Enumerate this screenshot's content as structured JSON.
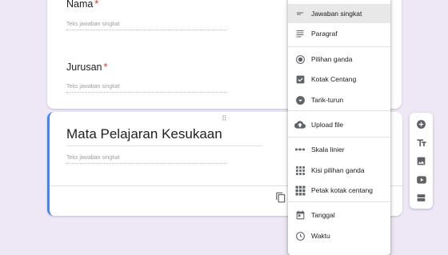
{
  "questions": [
    {
      "label": "Nama",
      "required_mark": "*",
      "answer_placeholder": "Teks jawaban singkat"
    },
    {
      "label": "Jurusan",
      "required_mark": "*",
      "answer_placeholder": "Teks jawaban singkat"
    }
  ],
  "active_question": {
    "drag_handle": "⠿",
    "title": "Mata Pelajaran Kesukaan",
    "answer_placeholder": "Teks jawaban singkat"
  },
  "type_menu": {
    "items": [
      {
        "label": "Jawaban singkat",
        "icon": "short-text-icon",
        "selected": true
      },
      {
        "label": "Paragraf",
        "icon": "paragraph-icon"
      },
      {
        "label": "Pilihan ganda",
        "icon": "radio-icon"
      },
      {
        "label": "Kotak Centang",
        "icon": "checkbox-icon"
      },
      {
        "label": "Tarik-turun",
        "icon": "dropdown-icon"
      },
      {
        "label": "Upload file",
        "icon": "cloud-upload-icon"
      },
      {
        "label": "Skala linier",
        "icon": "linear-scale-icon"
      },
      {
        "label": "Kisi pilihan ganda",
        "icon": "grid-icon"
      },
      {
        "label": "Petak kotak centang",
        "icon": "checkbox-grid-icon"
      },
      {
        "label": "Tanggal",
        "icon": "calendar-icon"
      },
      {
        "label": "Waktu",
        "icon": "clock-icon"
      }
    ]
  },
  "side_toolbar": {
    "buttons": [
      "add-question-icon",
      "add-title-icon",
      "add-image-icon",
      "add-video-icon",
      "add-section-icon"
    ]
  },
  "colors": {
    "accent": "#4285f4",
    "required": "#d93025",
    "background": "#ede7f6"
  }
}
